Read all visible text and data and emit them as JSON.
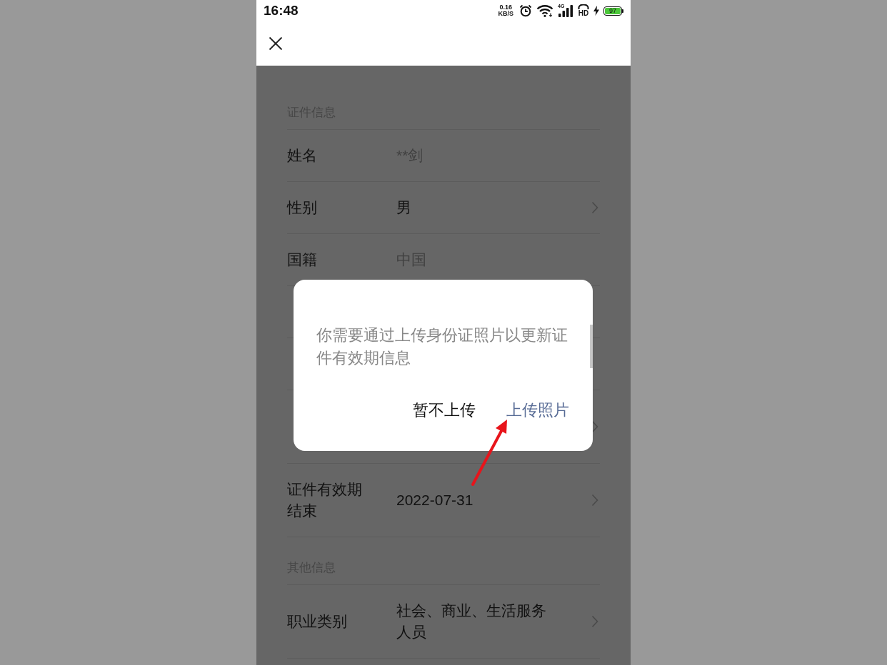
{
  "status_bar": {
    "time": "16:48",
    "net_speed": "0.16",
    "net_unit": "KB/S",
    "network": "4G",
    "hd": "HD",
    "battery": "97"
  },
  "sections": [
    {
      "title": "证件信息",
      "rows": [
        {
          "kind": "field",
          "label": "姓名",
          "value": "**剑",
          "muted": true,
          "chevron": false
        },
        {
          "kind": "field",
          "label": "性别",
          "value": "男",
          "muted": false,
          "chevron": true
        },
        {
          "kind": "field",
          "label": "国籍",
          "value": "中国",
          "muted": true,
          "chevron": false
        },
        {
          "kind": "covered"
        },
        {
          "kind": "covered"
        },
        {
          "kind": "covered_tall",
          "chevron": true
        },
        {
          "kind": "field",
          "label": "证件有效期结束",
          "value": "2022-07-31",
          "muted": false,
          "chevron": true
        }
      ]
    },
    {
      "title": "其他信息",
      "rows": [
        {
          "kind": "field",
          "label": "职业类别",
          "value": "社会、商业、生活服务人员",
          "muted": false,
          "chevron": true
        }
      ]
    }
  ],
  "dialog": {
    "message": "你需要通过上传身份证照片以更新证件有效期信息",
    "buttons": [
      {
        "label": "暂不上传",
        "primary": false
      },
      {
        "label": "上传照片",
        "primary": true
      }
    ]
  }
}
